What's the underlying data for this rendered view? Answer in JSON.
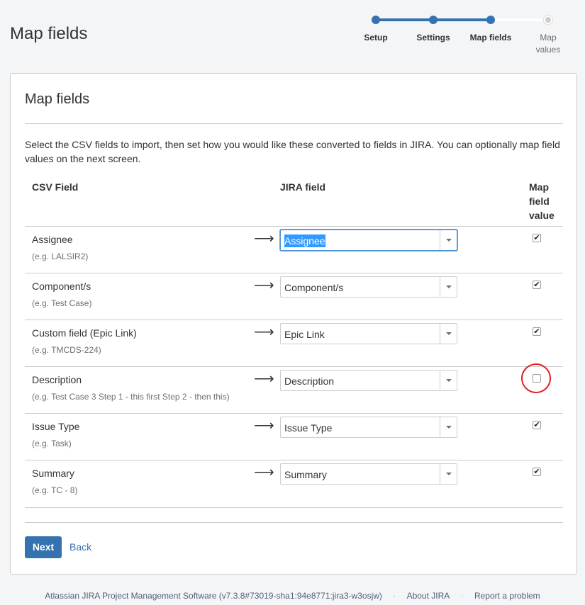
{
  "page_title": "Map fields",
  "progress": {
    "steps": [
      {
        "label": "Setup"
      },
      {
        "label": "Settings"
      },
      {
        "label": "Map fields"
      },
      {
        "label": "Map values"
      }
    ],
    "current_step": 3
  },
  "panel": {
    "title": "Map fields",
    "intro": "Select the CSV fields to import, then set how you would like these converted to fields in JIRA. You can optionally map field values on the next screen.",
    "headers": {
      "csv_field": "CSV Field",
      "jira_field": "JIRA field",
      "map_value": "Map field value"
    },
    "rows": [
      {
        "csv": "Assignee",
        "example": "(e.g. LALSIR2)",
        "arrow": "⟶",
        "jira": "Assignee",
        "map": true
      },
      {
        "csv": "Component/s",
        "example": "(e.g. Test Case)",
        "arrow": "⟶",
        "jira": "Component/s",
        "map": true
      },
      {
        "csv": "Custom field (Epic Link)",
        "example": "(e.g. TMCDS-224)",
        "arrow": "⟶",
        "jira": "Epic Link",
        "map": true
      },
      {
        "csv": "Description",
        "example": "(e.g. Test Case 3 Step 1 - this first Step 2 - then this)",
        "arrow": "⟶",
        "jira": "Description",
        "map": false
      },
      {
        "csv": "Issue Type",
        "example": "(e.g. Task)",
        "arrow": "⟶",
        "jira": "Issue Type",
        "map": true
      },
      {
        "csv": "Summary",
        "example": "(e.g. TC - 8)",
        "arrow": "⟶",
        "jira": "Summary",
        "map": true
      }
    ],
    "next_label": "Next",
    "back_label": "Back"
  },
  "footer": {
    "product": "Atlassian JIRA Project Management Software (v7.3.8#73019-sha1:94e8771:jira3-w3osjw)",
    "separator": "·",
    "about": "About JIRA",
    "report": "Report a problem"
  },
  "colors": {
    "accent": "#3572b0",
    "link": "#3b73af",
    "annotation": "#e02020"
  }
}
